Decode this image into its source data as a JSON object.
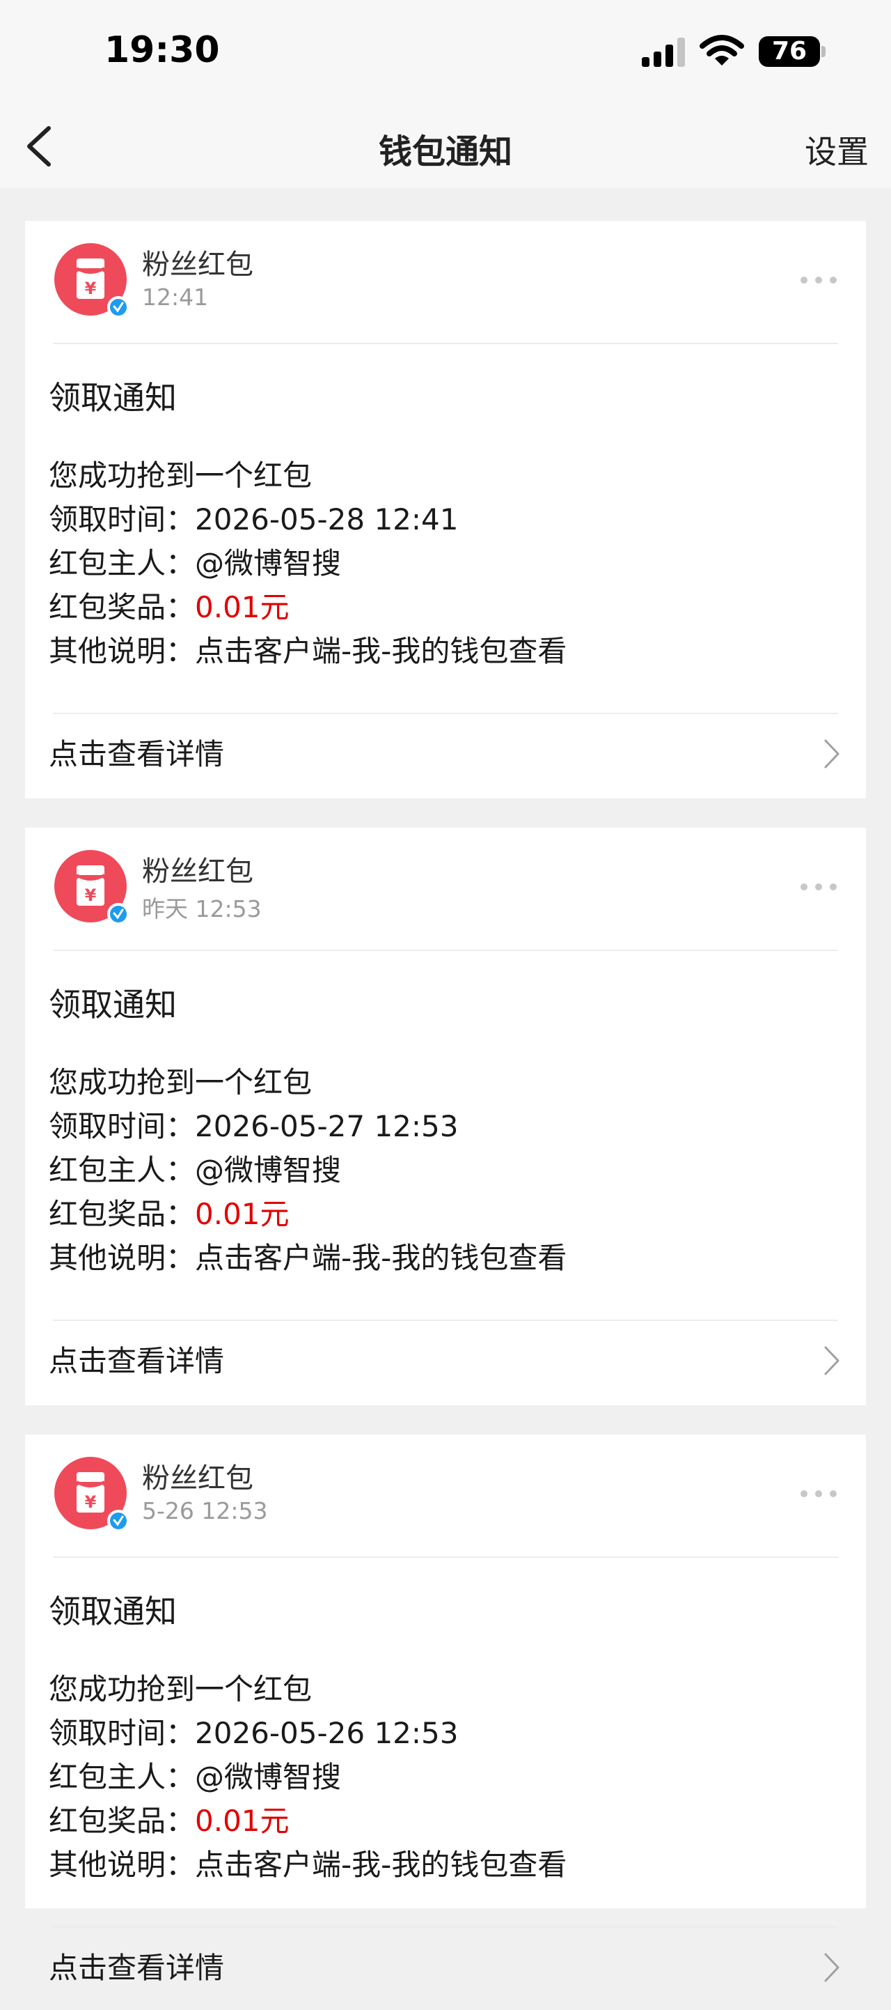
{
  "status_bar": {
    "time": "19:30",
    "battery": "76",
    "icons": [
      "signal-icon",
      "wifi-icon",
      "battery-icon"
    ]
  },
  "nav": {
    "title": "钱包通知",
    "settings_label": "设置",
    "back_icon": "chevron-left-icon"
  },
  "colors": {
    "accent_red": "#e10000",
    "avatar_red": "#ef4a5a",
    "verified_blue": "#1d9bf0"
  },
  "cards": [
    {
      "sender": "粉丝红包",
      "time": "12:41",
      "title": "领取通知",
      "line1": "您成功抢到一个红包",
      "time_label": "领取时间：",
      "time_value": "2026-05-28 12:41",
      "owner_label": "红包主人：",
      "owner_value": "@微博智搜",
      "prize_label": "红包奖品：",
      "prize_value": "0.01元",
      "note_label": "其他说明：",
      "note_value": "点击客户端-我-我的钱包查看",
      "detail": "点击查看详情"
    },
    {
      "sender": "粉丝红包",
      "time": "昨天 12:53",
      "title": "领取通知",
      "line1": "您成功抢到一个红包",
      "time_label": "领取时间：",
      "time_value": "2026-05-27 12:53",
      "owner_label": "红包主人：",
      "owner_value": "@微博智搜",
      "prize_label": "红包奖品：",
      "prize_value": "0.01元",
      "note_label": "其他说明：",
      "note_value": "点击客户端-我-我的钱包查看",
      "detail": "点击查看详情"
    },
    {
      "sender": "粉丝红包",
      "time": "5-26 12:53",
      "title": "领取通知",
      "line1": "您成功抢到一个红包",
      "time_label": "领取时间：",
      "time_value": "2026-05-26 12:53",
      "owner_label": "红包主人：",
      "owner_value": "@微博智搜",
      "prize_label": "红包奖品：",
      "prize_value": "0.01元",
      "note_label": "其他说明：",
      "note_value": "点击客户端-我-我的钱包查看",
      "detail": "点击查看详情"
    }
  ]
}
